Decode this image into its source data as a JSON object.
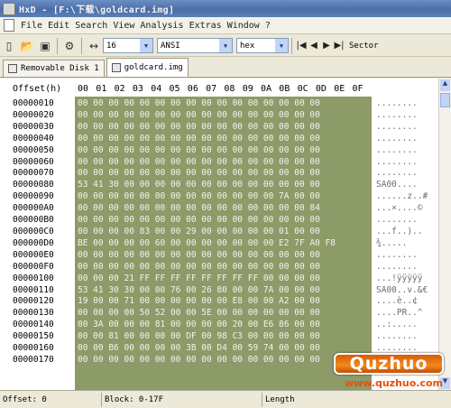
{
  "window": {
    "title": "HxD - [F:\\下载\\goldcard.img]"
  },
  "menu": [
    "File",
    "Edit",
    "Search",
    "View",
    "Analysis",
    "Extras",
    "Window",
    "?"
  ],
  "toolbar": {
    "columns_value": "16",
    "charset_value": "ANSI",
    "mode_value": "hex",
    "sector_label": "Sector"
  },
  "tabs": [
    {
      "label": "Removable Disk 1",
      "active": false
    },
    {
      "label": "goldcard.img",
      "active": true
    }
  ],
  "hex_header": {
    "offset_label": "Offset(h)",
    "columns": [
      "00",
      "01",
      "02",
      "03",
      "04",
      "05",
      "06",
      "07",
      "08",
      "09",
      "0A",
      "0B",
      "0C",
      "0D",
      "0E",
      "0F"
    ]
  },
  "offsets": [
    "00000010",
    "00000020",
    "00000030",
    "00000040",
    "00000050",
    "00000060",
    "00000070",
    "00000080",
    "00000090",
    "000000A0",
    "000000B0",
    "000000C0",
    "000000D0",
    "000000E0",
    "000000F0",
    "00000100",
    "00000110",
    "00000120",
    "00000130",
    "00000140",
    "00000150",
    "00000160",
    "00000170"
  ],
  "hex_rows": [
    "00 00 00 00 00 00 00 00 00 00 00 00 00 00 00 00",
    "00 00 00 00 00 00 00 00 00 00 00 00 00 00 00 00",
    "00 00 00 00 00 00 00 00 00 00 00 00 00 00 00 00",
    "00 00 00 00 00 00 00 00 00 00 00 00 00 00 00 00",
    "00 00 00 00 00 00 00 00 00 00 00 00 00 00 00 00",
    "00 00 00 00 00 00 00 00 00 00 00 00 00 00 00 00",
    "00 00 00 00 00 00 00 00 00 00 00 00 00 00 00 00",
    "53 41 30 00 00 00 00 00 00 00 00 00 00 00 00 00",
    "00 00 00 00 00 00 00 00 00 00 00 00 00 7A 00 00",
    "00 00 00 00 00 00 00 00 00 00 00 00 00 00 00 84",
    "00 00 00 00 00 00 00 00 00 00 00 00 00 00 00 00",
    "00 00 00 00 83 00 00 29 00 00 00 00 00 01 00 00",
    "BE 00 00 00 00 60 00 00 00 00 00 00 00 E2 7F A0 F8",
    "00 00 00 00 00 00 00 00 00 00 00 00 00 00 00 00",
    "00 00 00 00 00 00 00 00 00 00 00 00 00 00 00 00",
    "00 00 00 21 FF FF FF FF FF FF FF FF 00 00 00 00",
    "53 41 30 30 00 00 76 00 26 80 00 00 7A 00 00 00",
    "19 00 00 71 00 00 00 00 00 00 E8 00 00 A2 00 00",
    "00 00 00 00 50 52 00 00 5E 00 00 00 00 00 00 00",
    "00 3A 00 00 00 81 00 00 00 00 20 00 E6 86 00 00",
    "00 00 81 00 00 00 00 DF 00 98 C3 00 00 00 00 00",
    "00 00 B6 00 00 00 00 3B 00 D4 00 59 74 00 00 00",
    "00 00 00 00 00 00 00 00 00 00 00 00 00 00 00 00"
  ],
  "text_rows": [
    "........",
    "........",
    "........",
    "........",
    "........",
    "........",
    "........",
    "SA00....",
    "......z..#",
    "...×....©",
    "........",
    "...f..)..",
    "¾.....",
    "........",
    "........",
    "...!ÿÿÿÿÿ",
    "SA00..v.&€",
    "....è..¢",
    "....PR..^",
    "..:.....",
    "........",
    "........",
    "........"
  ],
  "status": {
    "offset": "Offset: 0",
    "block": "Block: 0-17F",
    "length": "Length"
  },
  "watermark": {
    "brand": "Quzhuo",
    "url": "www.quzhuo.com"
  },
  "colors": {
    "hex_background": "#8c9b68",
    "titlebar": "#5b80b8",
    "watermark": "#f08a1e"
  },
  "icons": [
    "app-icon",
    "document-icon",
    "new-file-icon",
    "open-folder-icon",
    "save-icon",
    "tools-icon",
    "columns-icon",
    "first-icon",
    "prev-icon",
    "next-icon",
    "last-icon",
    "disk-icon",
    "file-icon"
  ]
}
